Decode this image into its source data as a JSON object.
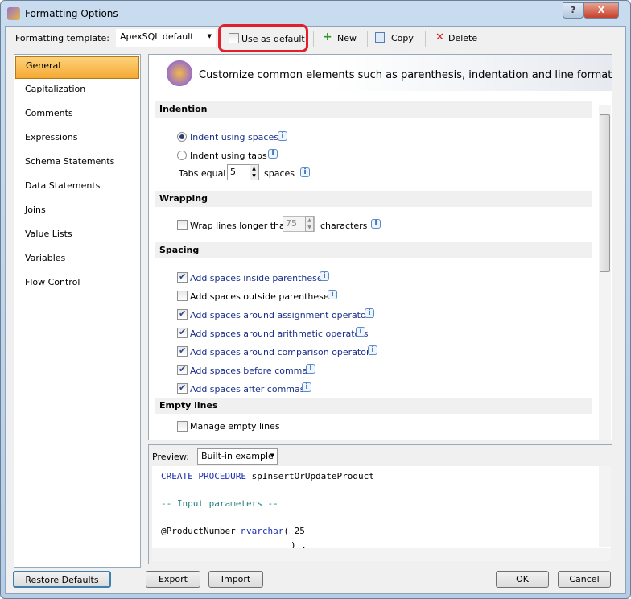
{
  "window": {
    "title": "Formatting Options",
    "help": "?",
    "close": "X"
  },
  "toolbar": {
    "template_label": "Formatting template:",
    "template_value": "ApexSQL default",
    "use_default": "Use as default",
    "new": "New",
    "copy": "Copy",
    "delete": "Delete"
  },
  "nav": [
    "General",
    "Capitalization",
    "Comments",
    "Expressions",
    "Schema Statements",
    "Data Statements",
    "Joins",
    "Value Lists",
    "Variables",
    "Flow Control"
  ],
  "banner": "Customize common elements such as parenthesis, indentation and line formatting",
  "indention": {
    "header": "Indention",
    "spaces": "Indent using spaces",
    "tabs": "Indent using tabs",
    "tabs_equal": "Tabs equal",
    "tabs_value": "5",
    "spaces_unit": "spaces"
  },
  "wrapping": {
    "header": "Wrapping",
    "wrap": "Wrap lines longer than",
    "wrap_value": "75",
    "unit": "characters"
  },
  "spacing": {
    "header": "Spacing",
    "items": [
      {
        "label": "Add spaces inside parentheses",
        "checked": true
      },
      {
        "label": "Add spaces outside parentheses",
        "checked": false
      },
      {
        "label": "Add spaces around assignment operators",
        "checked": true
      },
      {
        "label": "Add spaces around arithmetic operators",
        "checked": true
      },
      {
        "label": "Add spaces around comparison operators",
        "checked": true
      },
      {
        "label": "Add spaces before commas",
        "checked": true
      },
      {
        "label": "Add spaces after commas",
        "checked": true
      }
    ]
  },
  "empty_lines": {
    "header": "Empty lines",
    "manage": "Manage empty lines"
  },
  "preview": {
    "label": "Preview:",
    "source": "Built-in example",
    "code": {
      "l1a": "CREATE PROCEDURE",
      "l1b": " spInsertOrUpdateProduct",
      "l2": "-- Input parameters --",
      "l3a": "@ProductNumber ",
      "l3b": "nvarchar",
      "l3c": "( 25",
      "l4": ") ,"
    }
  },
  "buttons": {
    "restore": "Restore Defaults",
    "export": "Export",
    "import": "Import",
    "ok": "OK",
    "cancel": "Cancel"
  }
}
